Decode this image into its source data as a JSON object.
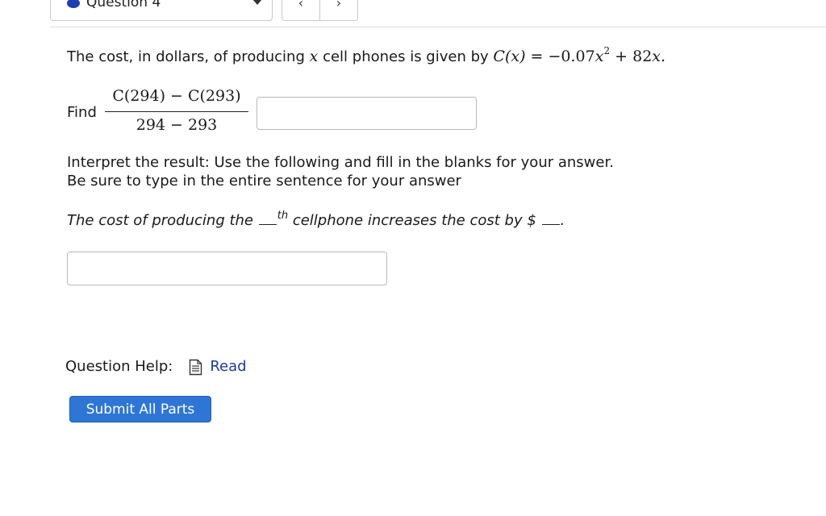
{
  "header": {
    "question_select": {
      "label": "Question 4",
      "dot_color": "#1f3fae"
    },
    "nav": {
      "prev_symbol": "‹",
      "next_symbol": "›"
    }
  },
  "problem": {
    "intro": "The cost, in dollars, of producing",
    "variable": "x",
    "intro_after": "cell phones is given by",
    "function": {
      "lhs": "C(x)",
      "equals": "=",
      "rhs_coef": "−0.07",
      "rhs_var": "x",
      "rhs_exp": "2",
      "rhs_rest_sign": "+ 82",
      "rhs_rest_var": "x",
      "end": "."
    }
  },
  "find": {
    "label": "Find",
    "numerator": "C(294) − C(293)",
    "denominator": "294 − 293",
    "answer_value": ""
  },
  "interpret": {
    "line1": "Interpret the result: Use the following and fill in the blanks for your answer.",
    "line2": "Be sure to type in the entire sentence for your answer"
  },
  "sentence": {
    "part1": "The cost of producing the",
    "ordinal_suffix": "th",
    "part2": "cellphone increases the cost by $",
    "end": "."
  },
  "answer2": {
    "value": ""
  },
  "help": {
    "label": "Question Help:",
    "link_label": "Read",
    "link_color": "#1d3a9f"
  },
  "submit": {
    "label": "Submit All Parts",
    "color": "#2e76d6"
  }
}
